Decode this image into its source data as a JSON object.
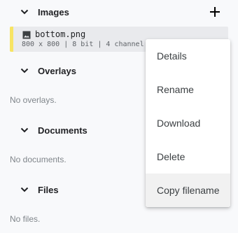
{
  "sections": {
    "images": {
      "title": "Images",
      "add_icon": "plus-icon"
    },
    "overlays": {
      "title": "Overlays",
      "empty": "No overlays."
    },
    "documents": {
      "title": "Documents",
      "empty": "No documents."
    },
    "files": {
      "title": "Files",
      "empty": "No files."
    }
  },
  "image_item": {
    "filename": "bottom.png",
    "meta": "800 x 800 | 8 bit | 4 channel",
    "icon": "image-icon",
    "marker_color": "#f7e463"
  },
  "context_menu": {
    "items": [
      "Details",
      "Rename",
      "Download",
      "Delete",
      "Copy filename"
    ],
    "highlighted": "Copy filename"
  }
}
